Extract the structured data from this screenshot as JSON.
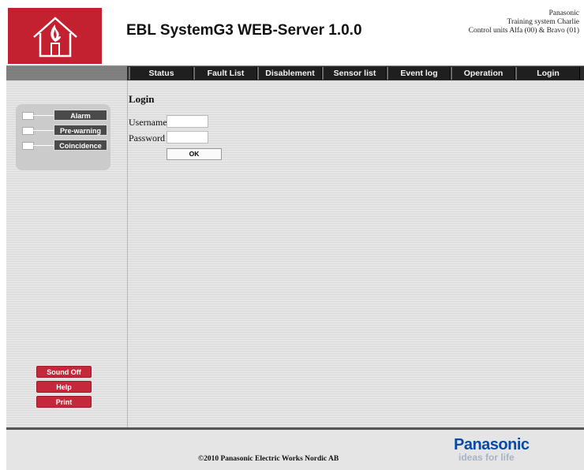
{
  "header": {
    "title": "EBL SystemG3 WEB-Server 1.0.0",
    "info_line1": "Panasonic",
    "info_line2": "Training system Charlie",
    "info_line3": "Control units Alfa (00) & Bravo (01)",
    "logo_icon": "house-fire-icon",
    "brand_color": "#c3212f"
  },
  "nav": {
    "items": [
      {
        "label": "Status"
      },
      {
        "label": "Fault List"
      },
      {
        "label": "Disablement"
      },
      {
        "label": "Sensor list"
      },
      {
        "label": "Event log"
      },
      {
        "label": "Operation"
      },
      {
        "label": "Login"
      }
    ]
  },
  "indicators": {
    "items": [
      {
        "label": "Alarm"
      },
      {
        "label": "Pre-warning"
      },
      {
        "label": "Coincidence"
      }
    ]
  },
  "side_buttons": {
    "sound_off": "Sound Off",
    "help": "Help",
    "print": "Print"
  },
  "login": {
    "title": "Login",
    "username_label": "Username",
    "password_label": "Password",
    "username_value": "",
    "password_value": "",
    "ok_label": "OK"
  },
  "footer": {
    "copyright": "©2010 Panasonic Electric Works Nordic AB",
    "brand_name": "Panasonic",
    "brand_tagline": "ideas for life"
  }
}
